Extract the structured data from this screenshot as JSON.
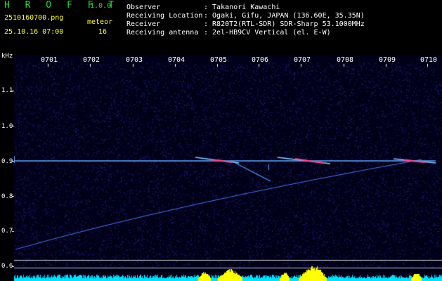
{
  "header": {
    "app_name": "H R O F F T",
    "version": "1.0.0",
    "file_name": "2510160700.png",
    "datetime": "25.10.16 07:00",
    "meteor_label": "meteor",
    "meteor_count": "16",
    "info_rows": [
      {
        "key": "Observer",
        "value": ": Takanori Kawachi"
      },
      {
        "key": "Receiving Location",
        "value": ": Ogaki, Gifu, JAPAN (136.60E, 35.35N)"
      },
      {
        "key": "Receiver",
        "value": ": R820T2(RTL-SDR) SDR-Sharp 53.1000MHz"
      },
      {
        "key": "Receiving antenna",
        "value": ": 2el-HB9CV Vertical (el. E-W)"
      }
    ]
  },
  "axes": {
    "y_unit": "kHz",
    "y_ticks": [
      "1.1",
      "1.0",
      "0.9",
      "0.8",
      "0.7",
      "0.6"
    ],
    "x_ticks": [
      "0701",
      "0702",
      "0703",
      "0704",
      "0705",
      "0706",
      "0707",
      "0708",
      "0709",
      "0710"
    ]
  },
  "colors": {
    "header_green": "#22dd33",
    "header_yellow": "#ffff33",
    "background_noise": "#0a0a4a",
    "carrier_line": "#66aaff",
    "meteor_trail": "#ff4488",
    "signal_yellow": "#ffff00",
    "signal_cyan": "#00e0ff"
  }
}
